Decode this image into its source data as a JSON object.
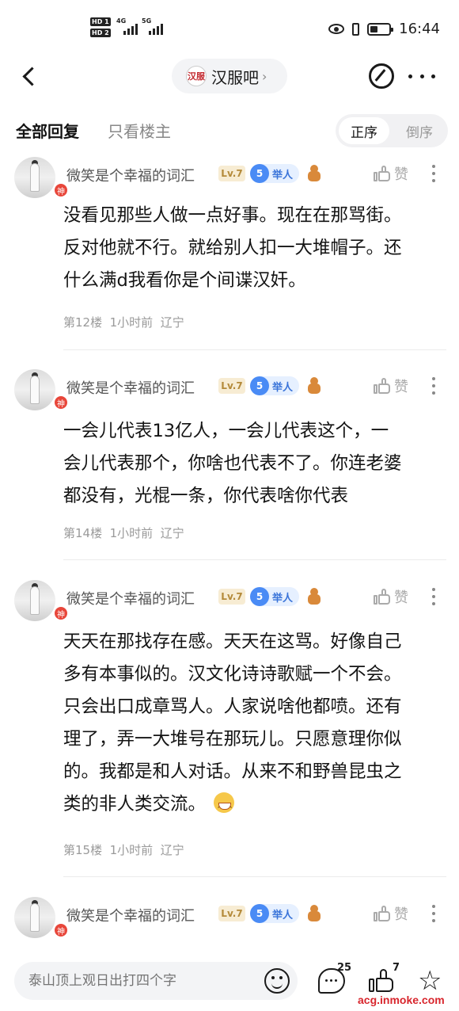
{
  "status_bar": {
    "hd1": "HD 1",
    "hd2": "HD 2",
    "net1": "4G",
    "net2": "5G",
    "time": "16:44"
  },
  "nav": {
    "forum_logo_text": "汉服",
    "forum_name": "汉服吧",
    "forum_chevron": "›"
  },
  "filter": {
    "tab_all": "全部回复",
    "tab_op_only": "只看楼主",
    "order_asc": "正序",
    "order_desc": "倒序"
  },
  "replies": [
    {
      "username": "微笑是个幸福的词汇",
      "level": "Lv.7",
      "medal_num": "5",
      "medal_text": "举人",
      "avatar_badge": "神",
      "like_label": "赞",
      "lines": [
        "没看见那些人做一点好事。现在在那骂街。",
        "反对他就不行。就给别人扣一大堆帽子。还",
        "什么满d我看你是个间谍汉奸。"
      ],
      "floor": "第12楼",
      "time": "1小时前",
      "location": "辽宁"
    },
    {
      "username": "微笑是个幸福的词汇",
      "level": "Lv.7",
      "medal_num": "5",
      "medal_text": "举人",
      "avatar_badge": "神",
      "like_label": "赞",
      "lines": [
        "一会儿代表13亿人，一会儿代表这个，一",
        "会儿代表那个，你啥也代表不了。你连老婆",
        "都没有，光棍一条，你代表啥你代表"
      ],
      "floor": "第14楼",
      "time": "1小时前",
      "location": "辽宁"
    },
    {
      "username": "微笑是个幸福的词汇",
      "level": "Lv.7",
      "medal_num": "5",
      "medal_text": "举人",
      "avatar_badge": "神",
      "like_label": "赞",
      "lines": [
        "天天在那找存在感。天天在这骂。好像自己",
        "多有本事似的。汉文化诗诗歌赋一个不会。",
        "只会出口成章骂人。人家说啥他都喷。还有",
        "理了，弄一大堆号在那玩儿。只愿意理你似",
        "的。我都是和人对话。从来不和野兽昆虫之",
        "类的非人类交流。"
      ],
      "floor": "第15楼",
      "time": "1小时前",
      "location": "辽宁"
    },
    {
      "username": "微笑是个幸福的词汇",
      "level": "Lv.7",
      "medal_num": "5",
      "medal_text": "举人",
      "avatar_badge": "神",
      "like_label": "赞"
    }
  ],
  "bottom": {
    "input_placeholder": "泰山顶上观日出打四个字",
    "comment_count": "25",
    "like_count": "7",
    "watermark": "acg.inmoke.com"
  }
}
